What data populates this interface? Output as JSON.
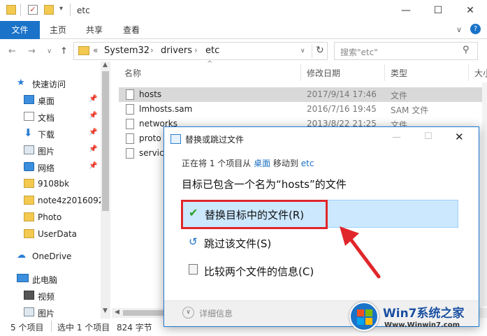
{
  "window": {
    "title": "etc"
  },
  "ribbon": {
    "tabs": [
      "文件",
      "主页",
      "共享",
      "查看"
    ]
  },
  "address": {
    "path": [
      "System32",
      "drivers",
      "etc"
    ],
    "chevron": "«"
  },
  "search": {
    "placeholder": "搜索\"etc\""
  },
  "nav": {
    "quick_access": "快速访问",
    "items": [
      "桌面",
      "文档",
      "下载",
      "图片",
      "网络",
      "9108bk",
      "note4z2016092",
      "Photo",
      "UserData"
    ],
    "onedrive": "OneDrive",
    "this_pc": "此电脑",
    "pc_items": [
      "视频",
      "图片"
    ]
  },
  "columns": {
    "name": "名称",
    "date": "修改日期",
    "type": "类型",
    "size": "大小"
  },
  "files": [
    {
      "name": "hosts",
      "date": "2017/9/14 17:46",
      "type": "文件"
    },
    {
      "name": "lmhosts.sam",
      "date": "2016/7/16 19:45",
      "type": "SAM 文件"
    },
    {
      "name": "networks",
      "date": "2013/8/22 21:25",
      "type": "文件"
    },
    {
      "name": "proto",
      "date": "",
      "type": ""
    },
    {
      "name": "servic",
      "date": "",
      "type": ""
    }
  ],
  "status": {
    "count": "5 个项目",
    "selected": "选中 1 个项目",
    "size": "824 字节"
  },
  "dialog": {
    "title": "替换或跳过文件",
    "line1_prefix": "正在将 1 个项目从 ",
    "line1_from": "桌面",
    "line1_mid": " 移动到 ",
    "line1_to": "etc",
    "heading": "目标已包含一个名为“hosts”的文件",
    "replace": "替换目标中的文件(R)",
    "skip": "跳过该文件(S)",
    "compare": "比较两个文件的信息(C)",
    "details": "详细信息"
  },
  "watermark": {
    "brand": "Win7系统之家",
    "url": "Www.Winwin7.com"
  },
  "colors": {
    "accent": "#1a73c8",
    "highlight": "#cce8ff",
    "callout": "#e0262a",
    "check": "#2ca02c"
  }
}
